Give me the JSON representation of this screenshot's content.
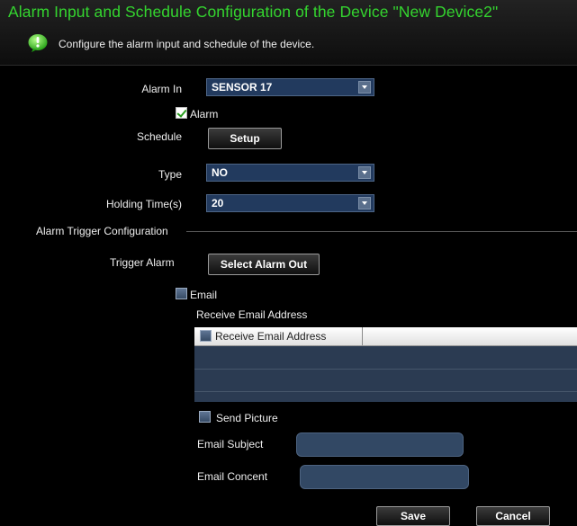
{
  "header": {
    "title": "Alarm Input and Schedule Configuration of the Device \"New Device2\"",
    "subtitle": "Configure the alarm input and schedule of the device.",
    "icon": "info-icon",
    "accent_color": "#34d52f"
  },
  "form": {
    "alarm_in": {
      "label": "Alarm In",
      "value": "SENSOR 17"
    },
    "alarm_checkbox": {
      "label": "Alarm",
      "checked": true
    },
    "schedule": {
      "label": "Schedule",
      "button": "Setup"
    },
    "type": {
      "label": "Type",
      "value": "NO"
    },
    "holding_time": {
      "label": "Holding Time(s)",
      "value": "20"
    }
  },
  "trigger": {
    "section_title": "Alarm Trigger Configuration",
    "trigger_alarm_label": "Trigger Alarm",
    "select_alarm_out_button": "Select Alarm Out",
    "email_checkbox_label": "Email",
    "email_checked": false,
    "receive_email_label": "Receive Email Address",
    "table_header": "Receive Email Address",
    "send_picture_label": "Send Picture",
    "send_picture_checked": false,
    "email_subject_label": "Email Subject",
    "email_subject_value": "",
    "email_content_label": "Email Concent",
    "email_content_value": ""
  },
  "footer": {
    "save_label": "Save",
    "cancel_label": "Cancel"
  }
}
